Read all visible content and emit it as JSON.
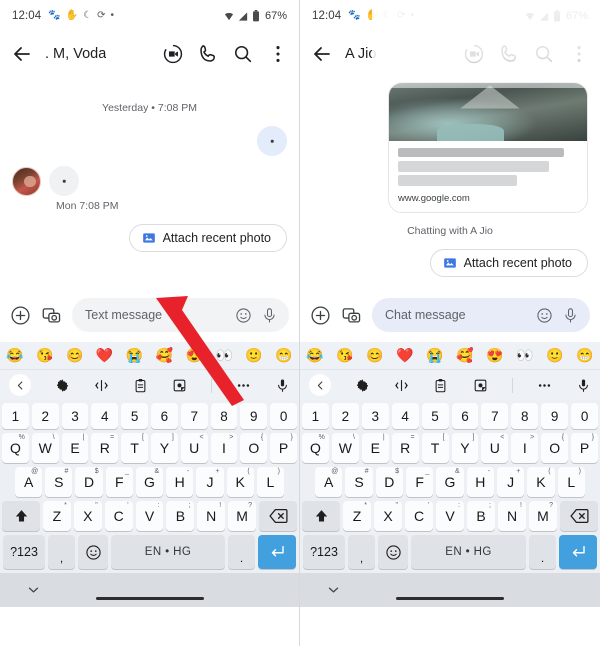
{
  "statusbar": {
    "time": "12:04",
    "left_icons": [
      "paw-icon",
      "hand-icon",
      "crescent-moon-icon",
      "swirl-icon",
      "dot-icon"
    ],
    "right_icons": [
      "wifi-icon",
      "signal-icon",
      "battery-icon"
    ],
    "battery": "67%"
  },
  "left_phone": {
    "appbar": {
      "back_icon": "back-arrow-icon",
      "title": ". M, Voda",
      "actions": [
        "video-call-icon",
        "phone-call-icon",
        "search-icon",
        "overflow-menu-icon"
      ]
    },
    "conversation": {
      "daystamp": "Yesterday • 7:08 PM",
      "timestamp": "Mon 7:08 PM"
    },
    "chip": {
      "label": "Attach recent photo",
      "icon": "image-icon"
    },
    "composer": {
      "placeholder": "Text message",
      "value": "",
      "plus_icon": "plus-circle-icon",
      "gallery_icon": "photo-camera-icon",
      "emoji_icon": "emoji-smile-icon",
      "mic_icon": "microphone-icon"
    }
  },
  "right_phone": {
    "appbar": {
      "back_icon": "back-arrow-icon",
      "title": "A Jio",
      "actions": [
        "video-call-icon",
        "phone-call-icon",
        "search-icon",
        "overflow-menu-icon"
      ]
    },
    "link_card": {
      "url": "www.google.com"
    },
    "conversation": {
      "chatting_with": "Chatting with A Jio"
    },
    "chip": {
      "label": "Attach recent photo",
      "icon": "image-icon"
    },
    "composer": {
      "placeholder": "Chat message",
      "value": "",
      "plus_icon": "plus-circle-icon",
      "gallery_icon": "photo-camera-icon",
      "emoji_icon": "emoji-smile-icon",
      "mic_icon": "microphone-icon"
    }
  },
  "keyboard": {
    "emoji_strip": [
      "😂",
      "😘",
      "😊",
      "❤️",
      "😭",
      "🥰",
      "😍",
      "👀",
      "🙂",
      "😁"
    ],
    "toolbar_icons": [
      "back-chevron-icon",
      "gear-icon",
      "text-cursor-move-icon",
      "clipboard-icon",
      "sticker-icon",
      "more-options-icon",
      "microphone-icon"
    ],
    "rows": [
      {
        "name": "numbers",
        "keys": [
          {
            "main": "1"
          },
          {
            "main": "2"
          },
          {
            "main": "3"
          },
          {
            "main": "4"
          },
          {
            "main": "5"
          },
          {
            "main": "6"
          },
          {
            "main": "7"
          },
          {
            "main": "8"
          },
          {
            "main": "9"
          },
          {
            "main": "0"
          }
        ]
      },
      {
        "name": "qwerty",
        "keys": [
          {
            "main": "Q",
            "sup": "%"
          },
          {
            "main": "W",
            "sup": "\\"
          },
          {
            "main": "E",
            "sup": "|"
          },
          {
            "main": "R",
            "sup": "="
          },
          {
            "main": "T",
            "sup": "["
          },
          {
            "main": "Y",
            "sup": "]"
          },
          {
            "main": "U",
            "sup": "<"
          },
          {
            "main": "I",
            "sup": ">"
          },
          {
            "main": "O",
            "sup": "{"
          },
          {
            "main": "P",
            "sup": "}"
          }
        ]
      },
      {
        "name": "asdf",
        "keys": [
          {
            "main": "A",
            "sup": "@"
          },
          {
            "main": "S",
            "sup": "#"
          },
          {
            "main": "D",
            "sup": "$"
          },
          {
            "main": "F",
            "sup": "_"
          },
          {
            "main": "G",
            "sup": "&"
          },
          {
            "main": "H",
            "sup": "-"
          },
          {
            "main": "J",
            "sup": "+"
          },
          {
            "main": "K",
            "sup": "("
          },
          {
            "main": "L",
            "sup": ")"
          }
        ]
      },
      {
        "name": "zxcv",
        "keys": [
          {
            "main": "Z",
            "sup": "*"
          },
          {
            "main": "X",
            "sup": "\""
          },
          {
            "main": "C",
            "sup": "'"
          },
          {
            "main": "V",
            "sup": ":"
          },
          {
            "main": "B",
            "sup": ";"
          },
          {
            "main": "N",
            "sup": "!"
          },
          {
            "main": "M",
            "sup": "?"
          }
        ]
      }
    ],
    "shift_key": "shift-icon",
    "backspace_key": "backspace-icon",
    "bottom_row": {
      "symbols": "?123",
      "comma": ",",
      "emoji": "emoji-key-icon",
      "space": "EN • HG",
      "period": ".",
      "enter": "enter-icon"
    },
    "accent_color": "#41a0dd"
  },
  "navbar": {
    "hide_keyboard_icon": "chevron-down-icon",
    "home_pill": "home-gesture-pill"
  },
  "annotations": {
    "arrow_color": "#e8222a",
    "arrows": [
      "pointer-arrow-left",
      "pointer-arrow-right"
    ]
  }
}
